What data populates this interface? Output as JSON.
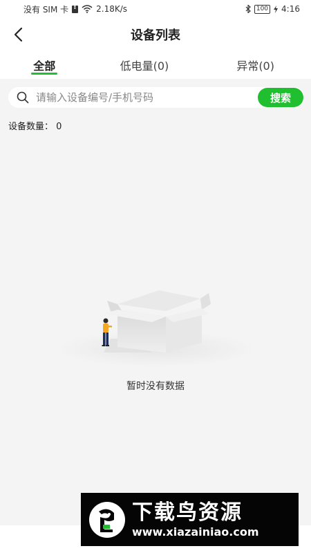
{
  "status_bar": {
    "carrier": "没有 SIM 卡",
    "speed": "2.18K/s",
    "battery": "100",
    "time": "4:16"
  },
  "header": {
    "title": "设备列表"
  },
  "tabs": [
    {
      "label": "全部",
      "active": true
    },
    {
      "label": "低电量(0)",
      "active": false
    },
    {
      "label": "异常(0)",
      "active": false
    }
  ],
  "search": {
    "placeholder": "请输入设备编号/手机号码",
    "value": "",
    "button_label": "搜索"
  },
  "device_count": "设备数量：  0",
  "empty_state": {
    "text": "暂时没有数据"
  },
  "watermark": {
    "title": "下载鸟资源",
    "url": "www.xiazainiao.com"
  },
  "colors": {
    "accent": "#1fbf2f",
    "background": "#f4f4f4"
  }
}
